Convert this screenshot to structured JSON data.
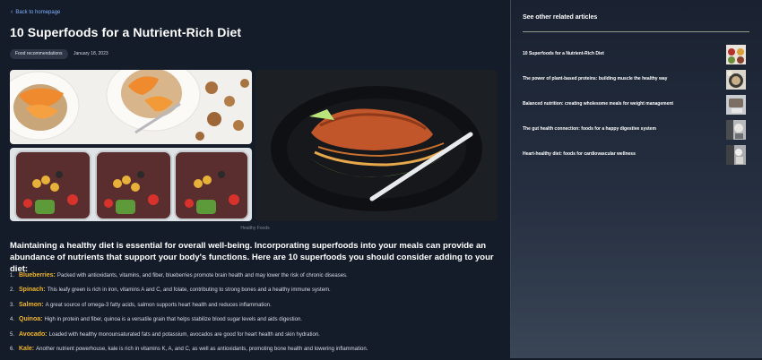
{
  "nav": {
    "back_label": "Back to homepage",
    "back_icon": "chevron-left-icon"
  },
  "article": {
    "title": "10 Superfoods for a Nutrient-Rich Diet",
    "tag": "Food recommendations",
    "date": "January 18, 2023",
    "image_caption": "Healthy Foods",
    "intro": "Maintaining a healthy diet is essential for overall well-being. Incorporating superfoods into your meals can provide an abundance of nutrients that support your body's functions. Here are 10 superfoods you should consider adding to your diet:",
    "items": [
      {
        "num": "1.",
        "name": "Blueberries:",
        "text": "Packed with antioxidants, vitamins, and fiber, blueberries promote brain health and may lower the risk of chronic diseases."
      },
      {
        "num": "2.",
        "name": "Spinach:",
        "text": "This leafy green is rich in iron, vitamins A and C, and folate, contributing to strong bones and a healthy immune system."
      },
      {
        "num": "3.",
        "name": "Salmon:",
        "text": "A great source of omega-3 fatty acids, salmon supports heart health and reduces inflammation."
      },
      {
        "num": "4.",
        "name": "Quinoa:",
        "text": "High in protein and fiber, quinoa is a versatile grain that helps stabilize blood sugar levels and aids digestion."
      },
      {
        "num": "5.",
        "name": "Avocado:",
        "text": "Loaded with healthy monounsaturated fats and potassium, avocados are good for heart health and skin hydration."
      },
      {
        "num": "6.",
        "name": "Kale:",
        "text": "Another nutrient powerhouse, kale is rich in vitamins K, A, and C, as well as antioxidants, promoting bone health and lowering inflammation."
      }
    ]
  },
  "sidebar": {
    "title": "See other related articles",
    "articles": [
      {
        "label": "10 Superfoods for a Nutrient-Rich Diet"
      },
      {
        "label": "The power of plant-based proteins: building muscle the healthy way"
      },
      {
        "label": "Balanced nutrition: creating wholesome meals for weight management"
      },
      {
        "label": "The gut health connection: foods for a happy digestive system"
      },
      {
        "label": "Heart-healthy diet: foods for cardiovascular wellness"
      }
    ]
  },
  "colors": {
    "accent": "#f2b62b",
    "link": "#7fb0ff",
    "background": "#141b29"
  }
}
